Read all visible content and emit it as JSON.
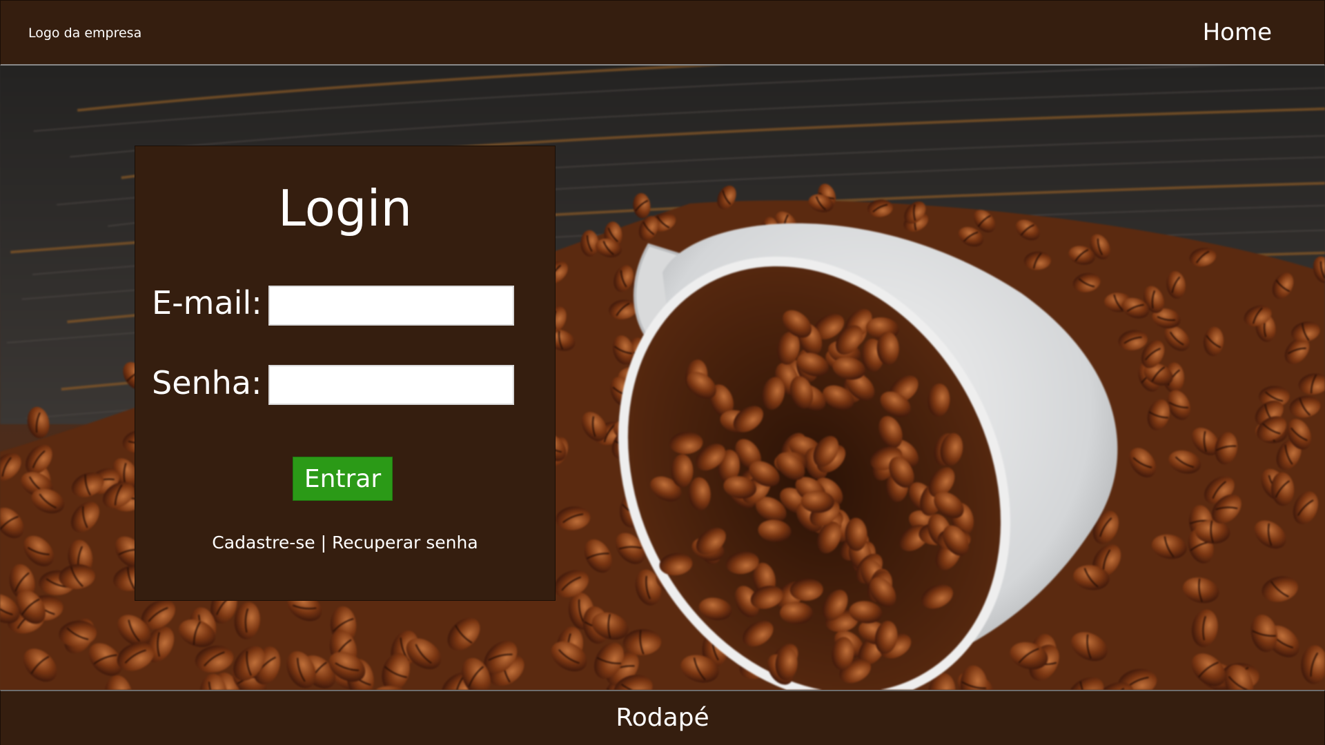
{
  "header": {
    "logo_text": "Logo da empresa",
    "nav_home": "Home"
  },
  "hero": {
    "background_image": "coffee-beans-spilled-cup-photo"
  },
  "login": {
    "title": "Login",
    "email_label": "E-mail:",
    "email_value": "",
    "password_label": "Senha:",
    "password_value": "",
    "submit_label": "Entrar",
    "register_link": "Cadastre-se",
    "separator": " | ",
    "recover_link": "Recuperar senha"
  },
  "footer": {
    "text": "Rodapé"
  },
  "colors": {
    "brown": "#351e0f",
    "button_green": "#2b9a17",
    "text": "#ffffff"
  }
}
